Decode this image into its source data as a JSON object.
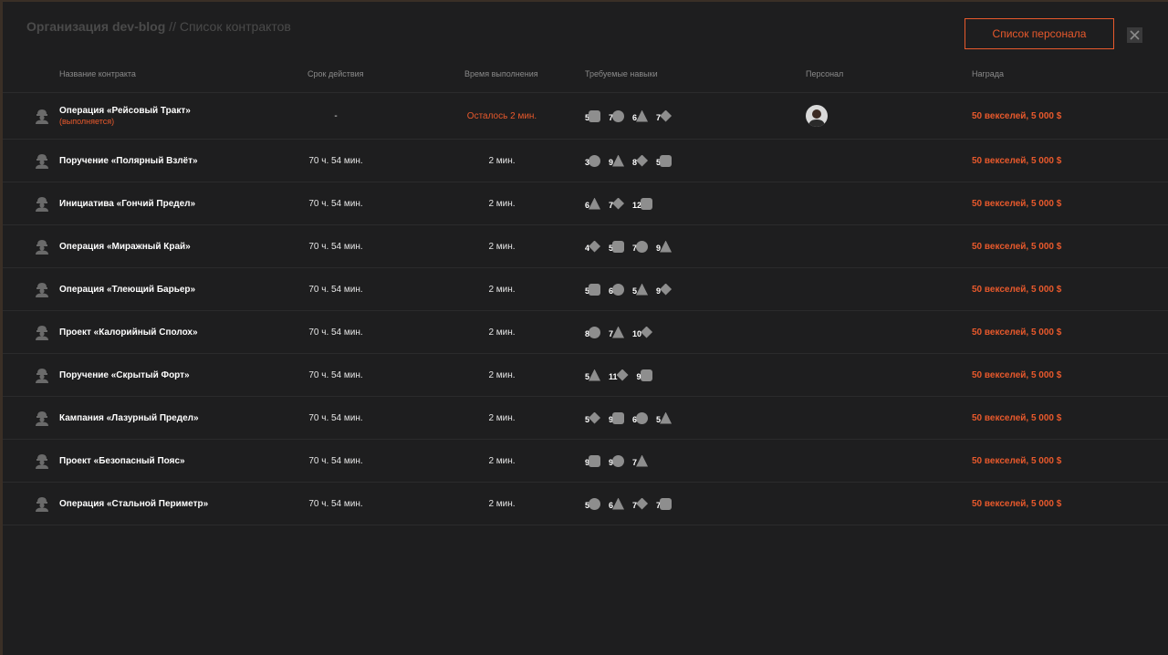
{
  "header": {
    "org": "Организация dev-blog",
    "separator": " // ",
    "page": "Список контрактов",
    "staff_button": "Список персонала"
  },
  "columns": {
    "name": "Название контракта",
    "duration": "Срок действия",
    "exec_time": "Время выполнения",
    "skills": "Требуемые навыки",
    "staff": "Персонал",
    "reward": "Награда"
  },
  "contracts": [
    {
      "name": "Операция «Рейсовый Тракт»",
      "status": "(выполняется)",
      "duration": "-",
      "time": "Осталось 2 мин.",
      "skills": [
        "5",
        "7",
        "6",
        "7"
      ],
      "reward": "50 векселей, 5 000 $"
    },
    {
      "name": "Поручение «Полярный Взлёт»",
      "status": "",
      "duration": "70 ч. 54 мин.",
      "time": "2 мин.",
      "skills": [
        "3",
        "9",
        "8",
        "5"
      ],
      "reward": "50 векселей, 5 000 $"
    },
    {
      "name": "Инициатива «Гончий Предел»",
      "status": "",
      "duration": "70 ч. 54 мин.",
      "time": "2 мин.",
      "skills": [
        "6",
        "7",
        "12"
      ],
      "reward": "50 векселей, 5 000 $"
    },
    {
      "name": "Операция «Миражный Край»",
      "status": "",
      "duration": "70 ч. 54 мин.",
      "time": "2 мин.",
      "skills": [
        "4",
        "5",
        "7",
        "9"
      ],
      "reward": "50 векселей, 5 000 $"
    },
    {
      "name": "Операция «Тлеющий Барьер»",
      "status": "",
      "duration": "70 ч. 54 мин.",
      "time": "2 мин.",
      "skills": [
        "5",
        "6",
        "5",
        "9"
      ],
      "reward": "50 векселей, 5 000 $"
    },
    {
      "name": "Проект «Калорийный Сполох»",
      "status": "",
      "duration": "70 ч. 54 мин.",
      "time": "2 мин.",
      "skills": [
        "8",
        "7",
        "10"
      ],
      "reward": "50 векселей, 5 000 $"
    },
    {
      "name": "Поручение «Скрытый Форт»",
      "status": "",
      "duration": "70 ч. 54 мин.",
      "time": "2 мин.",
      "skills": [
        "5",
        "11",
        "9"
      ],
      "reward": "50 векселей, 5 000 $"
    },
    {
      "name": "Кампания «Лазурный Предел»",
      "status": "",
      "duration": "70 ч. 54 мин.",
      "time": "2 мин.",
      "skills": [
        "5",
        "9",
        "6",
        "5"
      ],
      "reward": "50 векселей, 5 000 $"
    },
    {
      "name": "Проект «Безопасный Пояс»",
      "status": "",
      "duration": "70 ч. 54 мин.",
      "time": "2 мин.",
      "skills": [
        "9",
        "9",
        "7"
      ],
      "reward": "50 векселей, 5 000 $"
    },
    {
      "name": "Операция «Стальной Периметр»",
      "status": "",
      "duration": "70 ч. 54 мин.",
      "time": "2 мин.",
      "skills": [
        "5",
        "6",
        "7",
        "7"
      ],
      "reward": "50 векселей, 5 000 $"
    }
  ]
}
